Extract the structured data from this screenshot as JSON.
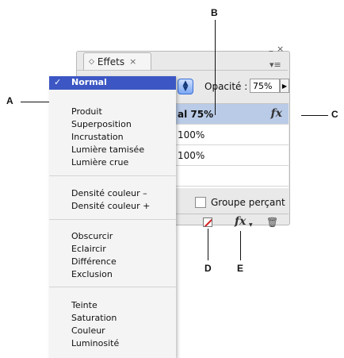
{
  "panel": {
    "tab_title": "Effets",
    "tab_close": "×",
    "tab_diamond": "◇",
    "min_glyph": "–",
    "close_glyph": "×",
    "menu_glyph": "▾≡",
    "opacity_label": "Opacité :",
    "opacity_value": "75%",
    "stepper_glyph": "▶",
    "blend_up": "▲",
    "blend_down": "▼",
    "rows": [
      {
        "label": "al 75%",
        "fx": "fx"
      },
      {
        "label": "100%"
      },
      {
        "label": "100%"
      },
      {
        "label": ""
      }
    ],
    "knockout_label": "Groupe perçant",
    "fx_button": "fx",
    "fx_arrow": "▼",
    "trash_glyph": "🗑"
  },
  "menu": {
    "check": "✓",
    "selected": "Normal",
    "groups": [
      [
        "Produit",
        "Superposition",
        "Incrustation",
        "Lumière tamisée",
        "Lumière crue"
      ],
      [
        "Densité couleur –",
        "Densité couleur +"
      ],
      [
        "Obscurcir",
        "Eclaircir",
        "Différence",
        "Exclusion"
      ],
      [
        "Teinte",
        "Saturation",
        "Couleur",
        "Luminosité"
      ]
    ]
  },
  "callouts": {
    "A": "A",
    "B": "B",
    "C": "C",
    "D": "D",
    "E": "E"
  },
  "colors": {
    "menu_highlight": "#3c57c4",
    "row_selected": "#b9cbe7"
  }
}
